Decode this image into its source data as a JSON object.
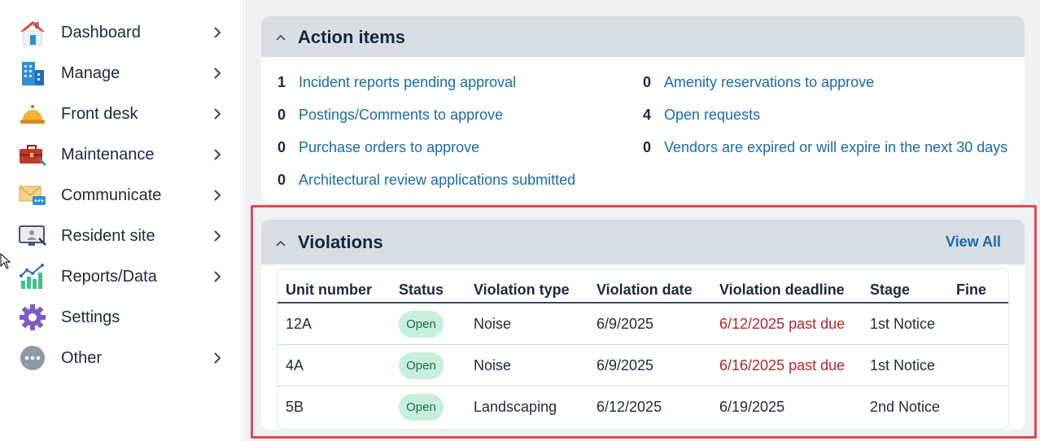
{
  "sidebar": {
    "items": [
      {
        "label": "Dashboard",
        "icon": "house-icon",
        "chevron": true
      },
      {
        "label": "Manage",
        "icon": "building-icon",
        "chevron": true
      },
      {
        "label": "Front desk",
        "icon": "service-bell-icon",
        "chevron": true
      },
      {
        "label": "Maintenance",
        "icon": "toolbox-icon",
        "chevron": true
      },
      {
        "label": "Communicate",
        "icon": "envelope-chat-icon",
        "chevron": true
      },
      {
        "label": "Resident site",
        "icon": "monitor-icon",
        "chevron": true
      },
      {
        "label": "Reports/Data",
        "icon": "bar-chart-icon",
        "chevron": true
      },
      {
        "label": "Settings",
        "icon": "gear-icon",
        "chevron": false
      },
      {
        "label": "Other",
        "icon": "more-dots-icon",
        "chevron": true
      }
    ]
  },
  "action_items": {
    "title": "Action items",
    "left": [
      {
        "count": "1",
        "label": "Incident reports pending approval"
      },
      {
        "count": "0",
        "label": "Postings/Comments to approve"
      },
      {
        "count": "0",
        "label": "Purchase orders to approve"
      },
      {
        "count": "0",
        "label": "Architectural review applications submitted"
      }
    ],
    "right": [
      {
        "count": "0",
        "label": "Amenity reservations to approve"
      },
      {
        "count": "4",
        "label": "Open requests"
      },
      {
        "count": "0",
        "label": "Vendors are expired or will expire in the next 30 days"
      }
    ]
  },
  "violations": {
    "title": "Violations",
    "view_all": "View All",
    "columns": [
      "Unit number",
      "Status",
      "Violation type",
      "Violation date",
      "Violation deadline",
      "Stage",
      "Fine"
    ],
    "rows": [
      {
        "unit": "12A",
        "status": "Open",
        "type": "Noise",
        "date": "6/9/2025",
        "deadline": "6/12/2025 past due",
        "deadline_past_due": true,
        "stage": "1st Notice",
        "fine": ""
      },
      {
        "unit": "4A",
        "status": "Open",
        "type": "Noise",
        "date": "6/9/2025",
        "deadline": "6/16/2025 past due",
        "deadline_past_due": true,
        "stage": "1st Notice",
        "fine": ""
      },
      {
        "unit": "5B",
        "status": "Open",
        "type": "Landscaping",
        "date": "6/12/2025",
        "deadline": "6/19/2025",
        "deadline_past_due": false,
        "stage": "2nd Notice",
        "fine": ""
      }
    ]
  },
  "colors": {
    "link": "#1a6aa8",
    "past_due": "#b3262a",
    "badge_bg": "#c7efdc",
    "highlight": "#e64552"
  }
}
